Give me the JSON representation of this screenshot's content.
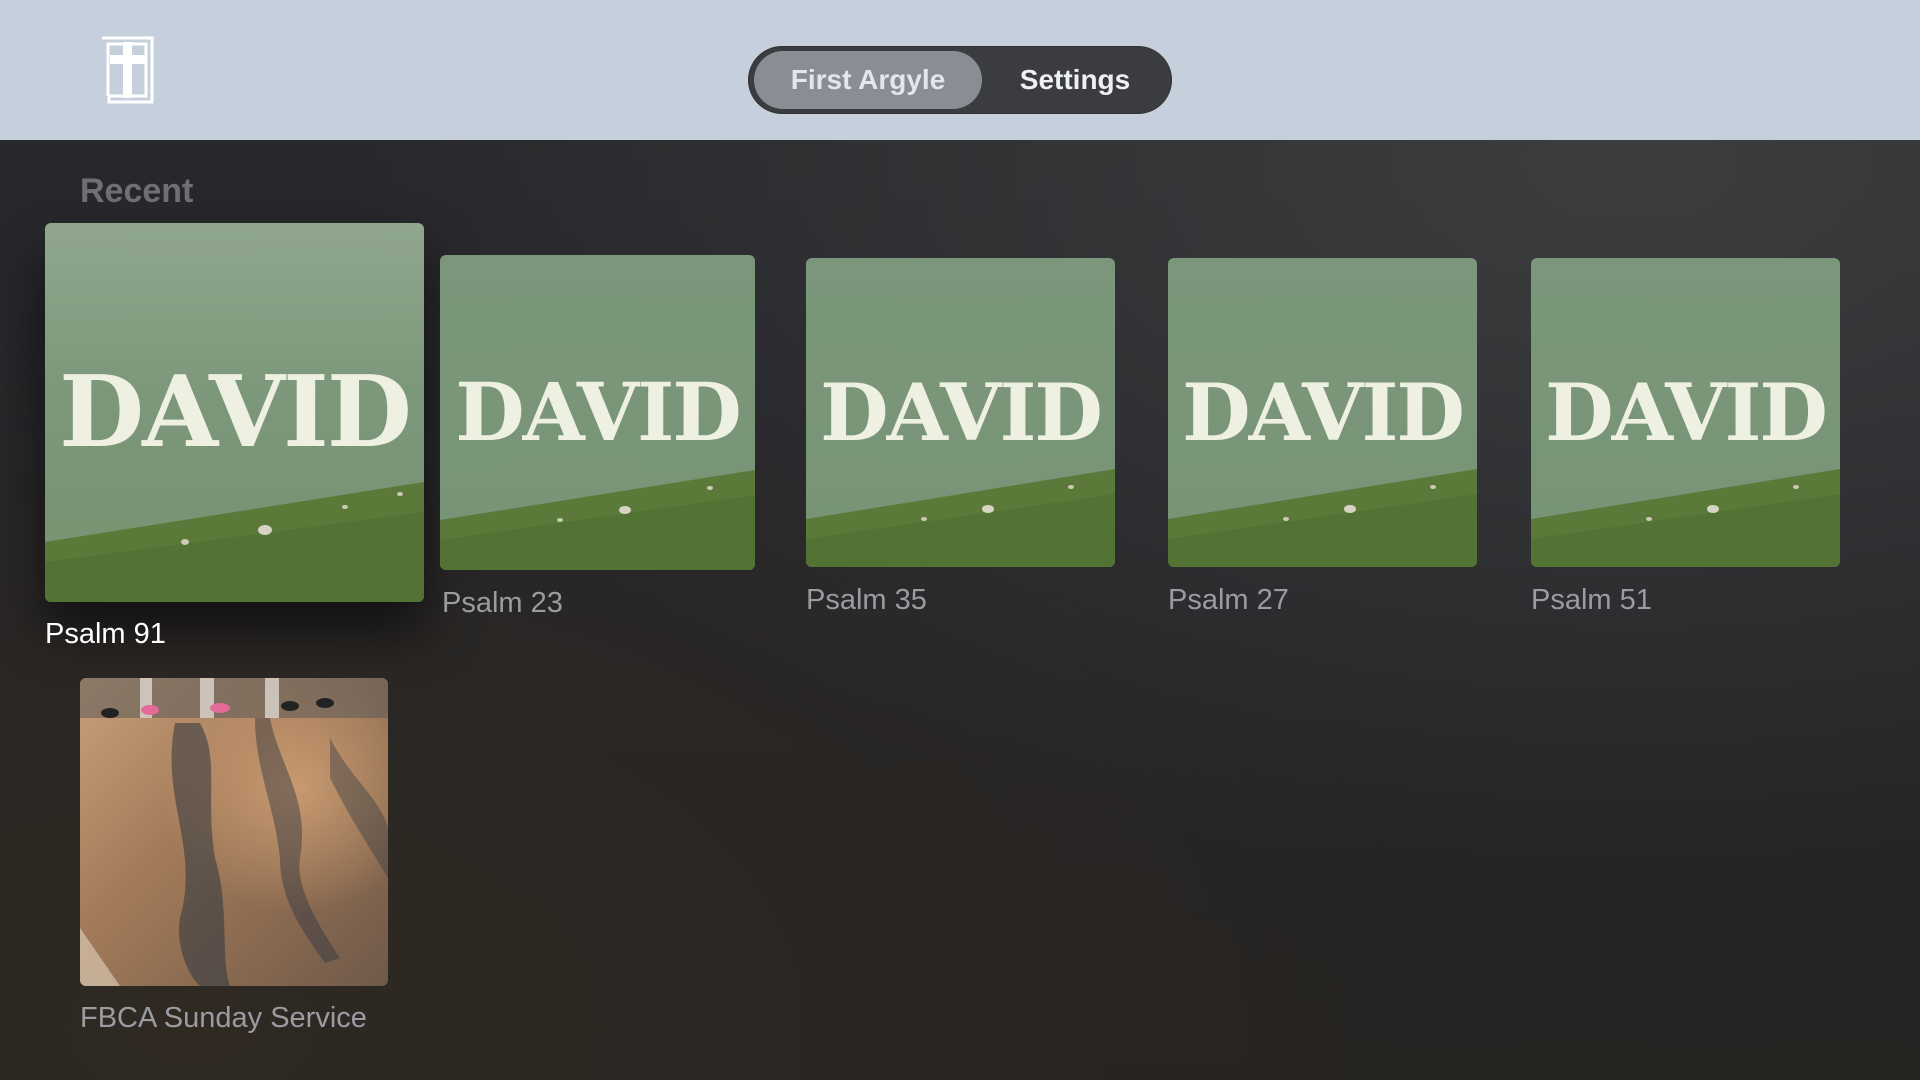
{
  "app": {
    "logo_icon": "cross-book-icon"
  },
  "tabs": [
    {
      "label": "First Argyle",
      "selected": true
    },
    {
      "label": "Settings",
      "selected": false
    }
  ],
  "section": {
    "title": "Recent"
  },
  "items": [
    {
      "title": "Psalm 91",
      "artwork_text": "DAVID",
      "focused": true
    },
    {
      "title": "Psalm 23",
      "artwork_text": "DAVID",
      "focused": false
    },
    {
      "title": "Psalm 35",
      "artwork_text": "DAVID",
      "focused": false
    },
    {
      "title": "Psalm 27",
      "artwork_text": "DAVID",
      "focused": false
    },
    {
      "title": "Psalm 51",
      "artwork_text": "DAVID",
      "focused": false
    },
    {
      "title": "FBCA Sunday Service",
      "artwork": "photo-street-shadows",
      "focused": false
    }
  ],
  "colors": {
    "topbar": "#c5d0dc",
    "artwork_green": "#7b967a",
    "caption": "#9a9ca2",
    "caption_focused": "#ffffff"
  }
}
